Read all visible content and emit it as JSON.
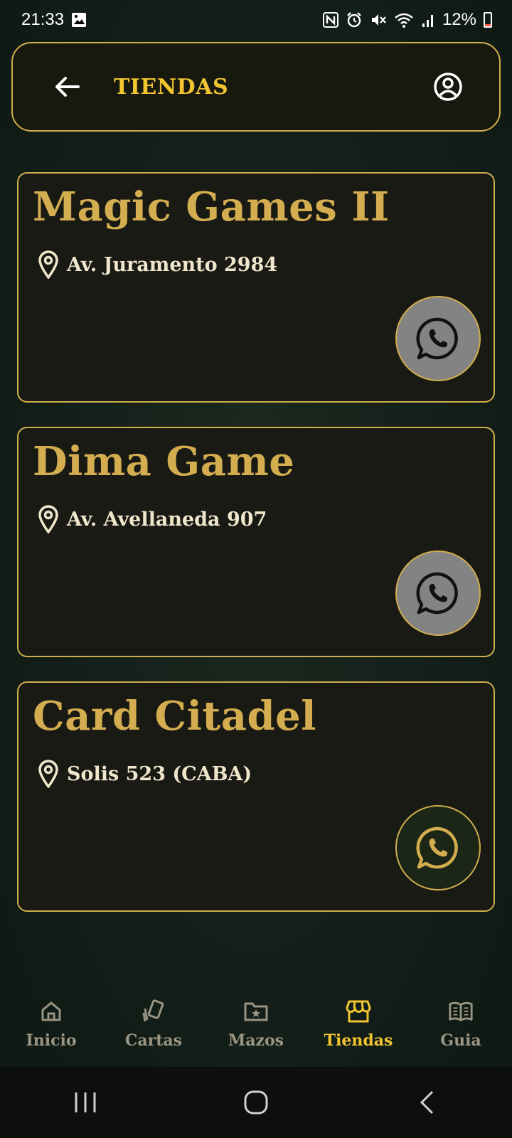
{
  "status_bar": {
    "time": "21:33",
    "battery": "12%",
    "icons": [
      "image-icon",
      "nfc-icon",
      "alarm-icon",
      "mute-icon",
      "wifi-icon",
      "signal-icon",
      "battery-icon"
    ]
  },
  "header": {
    "title": "TIENDAS",
    "back_icon": "arrow-left-icon",
    "profile_icon": "user-circle-icon"
  },
  "stores": [
    {
      "name": "Magic Games II",
      "address": "Av. Juramento 2984",
      "whatsapp_enabled": false
    },
    {
      "name": "Dima Game",
      "address": "Av. Avellaneda 907",
      "whatsapp_enabled": false
    },
    {
      "name": "Card Citadel",
      "address": "Solis 523 (CABA)",
      "whatsapp_enabled": true
    }
  ],
  "bottom_nav": {
    "items": [
      {
        "label": "Inicio",
        "icon": "home-icon",
        "active": false
      },
      {
        "label": "Cartas",
        "icon": "cards-icon",
        "active": false
      },
      {
        "label": "Mazos",
        "icon": "folder-star-icon",
        "active": false
      },
      {
        "label": "Tiendas",
        "icon": "store-icon",
        "active": true
      },
      {
        "label": "Guia",
        "icon": "book-icon",
        "active": false
      }
    ]
  },
  "colors": {
    "accent": "#f2c530",
    "gold_border": "#cfae4e",
    "store_name": "#d4ad50",
    "background": "#14201a"
  }
}
